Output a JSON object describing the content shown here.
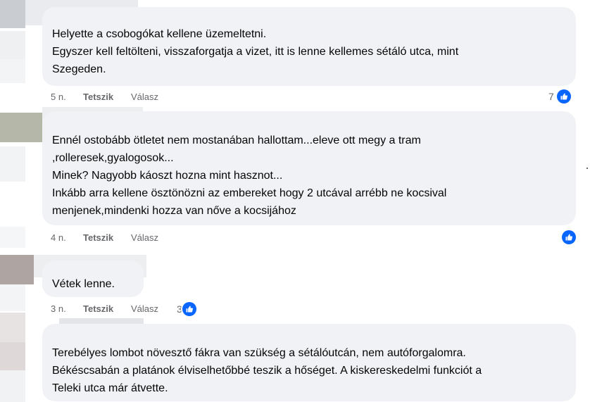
{
  "comments": [
    {
      "text": "Helyette a csobogókat kellene üzemeltetni.\nEgyszer kell feltölteni, visszaforgatja a vizet, itt is lenne kellemes sétáló utca, mint\nSzegeden.",
      "time": "5 n.",
      "like_label": "Tetszik",
      "reply_label": "Válasz",
      "reaction_count": "7"
    },
    {
      "text": "Ennél ostobább ötletet nem mostanában hallottam...eleve ott megy a tram\n,rolleresek,gyalogosok...\nMinek? Nagyobb káoszt hozna mint hasznot...\nInkább arra kellene ösztönözni az embereket hogy 2 utcával arrébb ne kocsival\nmenjenek,mindenki hozza van nőve a kocsijához",
      "time": "4 n.",
      "like_label": "Tetszik",
      "reply_label": "Válasz",
      "reaction_count": ""
    },
    {
      "text": "Vétek lenne.",
      "time": "3 n.",
      "like_label": "Tetszik",
      "reply_label": "Válasz",
      "reaction_count": "3"
    },
    {
      "text": "Terebélyes lombot növesztő fákra van szükség a sétálóutcán, nem autóforgalomra.\nBékéscsabán a platánok élviselhetőbbé teszik a hőséget. A kiskereskedelmi funkciót a\nTeleki utca már átvette.",
      "time": "",
      "like_label": "",
      "reply_label": "",
      "reaction_count": ""
    }
  ],
  "colors": {
    "bubble": "#f0f2f5",
    "reaction_blue": "#0866ff",
    "meta_text": "#65676b"
  },
  "icons": {
    "reaction": "thumbs-up-icon"
  }
}
